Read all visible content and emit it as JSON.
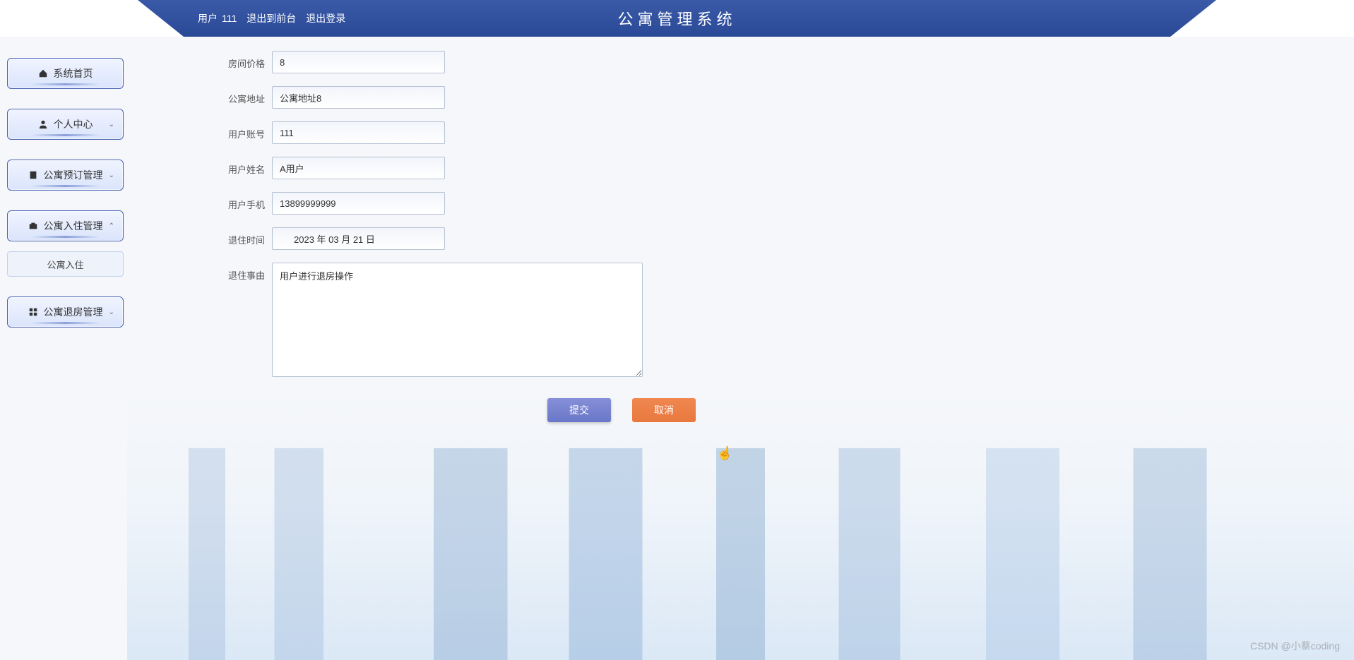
{
  "header": {
    "user_prefix": "用户",
    "username": "111",
    "logout_front": "退出到前台",
    "logout": "退出登录",
    "title": "公寓管理系统"
  },
  "sidebar": {
    "home": "系统首页",
    "personal": "个人中心",
    "booking": "公寓预订管理",
    "checkin": "公寓入住管理",
    "checkin_sub": "公寓入住",
    "checkout": "公寓退房管理"
  },
  "form": {
    "room_price": {
      "label": "房间价格",
      "value": "8"
    },
    "address": {
      "label": "公寓地址",
      "value": "公寓地址8"
    },
    "account": {
      "label": "用户账号",
      "value": "111"
    },
    "name": {
      "label": "用户姓名",
      "value": "A用户"
    },
    "phone": {
      "label": "用户手机",
      "value": "13899999999"
    },
    "checkout_time": {
      "label": "退住时间",
      "value": "2023 年 03 月 21 日"
    },
    "reason": {
      "label": "退住事由",
      "value": "用户进行退房操作"
    }
  },
  "buttons": {
    "submit": "提交",
    "cancel": "取消"
  },
  "watermark": "CSDN @小蔡coding"
}
